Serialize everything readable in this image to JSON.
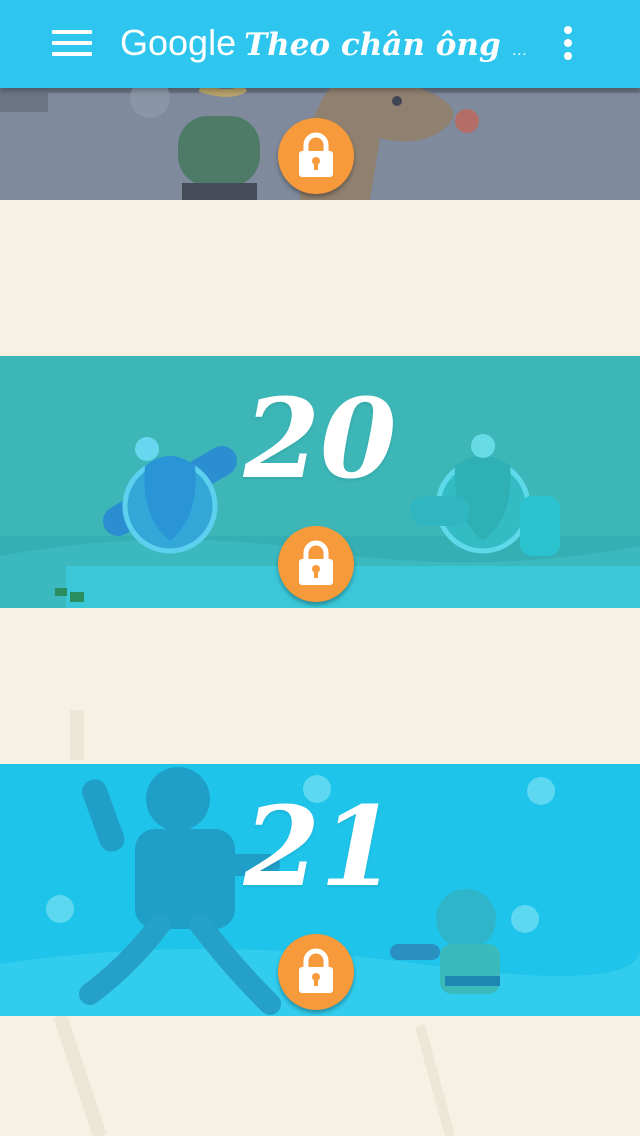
{
  "appbar": {
    "brand": "Google",
    "subtitle": "Theo chân ông gi...",
    "background": "#2ec6ee",
    "menu_icon": "hamburger-menu-icon",
    "more_icon": "more-vertical-icon"
  },
  "cards": [
    {
      "day": "",
      "status": "locked",
      "color": "#7f8a9c"
    },
    {
      "day": "20",
      "status": "locked",
      "color": "#3cb6b7"
    },
    {
      "day": "21",
      "status": "locked",
      "color": "#1fc4ea"
    }
  ],
  "lock": {
    "icon": "padlock-icon",
    "color": "#f79a3b"
  },
  "page": {
    "background": "#f5f1e3"
  }
}
